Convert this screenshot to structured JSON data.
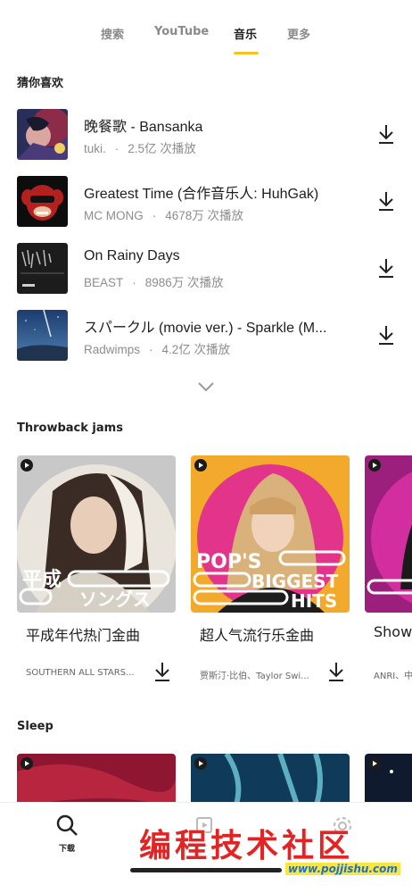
{
  "tabs": [
    {
      "label": "搜索",
      "active": false
    },
    {
      "label": "YouTube",
      "active": false
    },
    {
      "label": "音乐",
      "active": true
    },
    {
      "label": "更多",
      "active": false
    }
  ],
  "accent_color": "#f6c323",
  "recommend": {
    "title": "猜你喜欢",
    "songs": [
      {
        "title": "晚餐歌 - Bansanka",
        "artist": "tuki.",
        "plays": "2.5亿 次播放"
      },
      {
        "title": "Greatest Time (合作音乐人: HuhGak)",
        "artist": "MC MONG",
        "plays": "4678万 次播放"
      },
      {
        "title": "On Rainy Days",
        "artist": "BEAST",
        "plays": "8986万 次播放"
      },
      {
        "title": "スパークル (movie ver.) - Sparkle (M...",
        "artist": "Radwimps",
        "plays": "4.2亿 次播放"
      }
    ]
  },
  "throwback": {
    "title": "Throwback jams",
    "cards": [
      {
        "title": "平成年代热门金曲",
        "subtitle": "SOUTHERN ALL STARS...",
        "art_text_line1": "平成",
        "art_text_line2": "ソングス"
      },
      {
        "title": "超人气流行乐金曲",
        "subtitle": "贾斯汀·比伯、Taylor Swi...",
        "art_text_line1": "POP'S",
        "art_text_line2": "BIGGEST",
        "art_text_line3": "HITS"
      },
      {
        "title": "Show",
        "subtitle": "ANRI、中森"
      }
    ]
  },
  "sleep": {
    "title": "Sleep"
  },
  "bottom_nav": {
    "items": [
      {
        "label": "下载",
        "icon": "search-icon"
      }
    ]
  },
  "watermark": {
    "text": "编程技术社区",
    "url": "www.pojjishu.com"
  }
}
